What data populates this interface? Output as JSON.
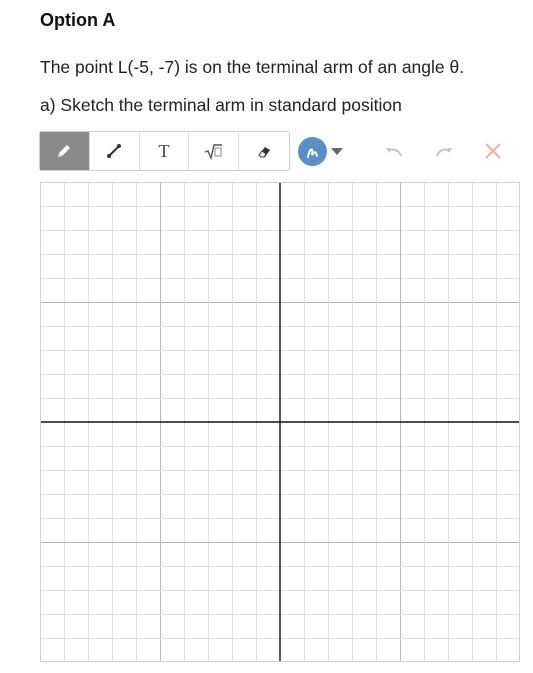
{
  "heading": "Option A",
  "question": {
    "prompt": "The point L(-5, -7) is on the terminal arm of an angle θ.",
    "part_a": "a) Sketch the terminal arm in standard position"
  },
  "toolbar": {
    "tools": [
      {
        "name": "pencil-icon"
      },
      {
        "name": "line-icon"
      },
      {
        "name": "text-icon",
        "glyph": "T"
      },
      {
        "name": "math-icon",
        "glyph": "√□"
      },
      {
        "name": "eraser-icon"
      }
    ],
    "color": "#5b8fc7"
  },
  "colors": {
    "accent": "#5b8fc7",
    "clear": "#f0b0b0",
    "disabled": "#c8c8c8"
  }
}
